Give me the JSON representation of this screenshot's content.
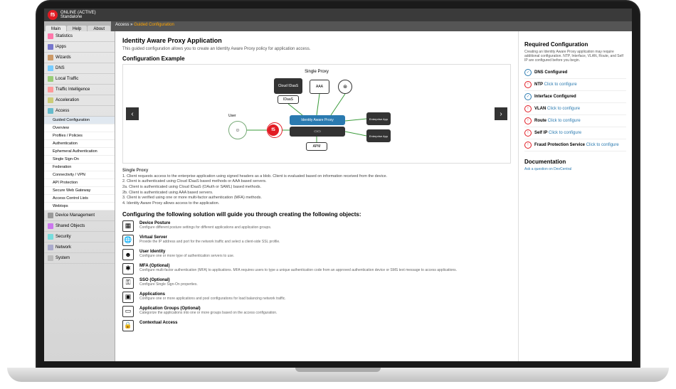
{
  "header": {
    "status": "ONLINE (ACTIVE)",
    "mode": "Standalone"
  },
  "tabs": [
    "Main",
    "Help",
    "About"
  ],
  "breadcrumb": {
    "root": "Access",
    "current": "Guided Configuration"
  },
  "sidebar": {
    "items": [
      {
        "label": "Statistics"
      },
      {
        "label": "iApps"
      },
      {
        "label": "Wizards"
      },
      {
        "label": "DNS"
      },
      {
        "label": "Local Traffic"
      },
      {
        "label": "Traffic Intelligence"
      },
      {
        "label": "Acceleration"
      },
      {
        "label": "Access",
        "expanded": true,
        "children": [
          "Guided Configuration",
          "Overview",
          "Profiles / Policies",
          "Authentication",
          "Ephemeral Authentication",
          "Single Sign-On",
          "Federation",
          "Connectivity / VPN",
          "API Protection",
          "Secure Web Gateway",
          "Access Control Lists",
          "Webtops"
        ]
      },
      {
        "label": "Device Management"
      },
      {
        "label": "Shared Objects"
      },
      {
        "label": "Security"
      },
      {
        "label": "Network"
      },
      {
        "label": "System"
      }
    ]
  },
  "page": {
    "title": "Identity Aware Proxy Application",
    "description": "This guided configuration allows you to create an Identity Aware Proxy policy for application access.",
    "example_heading": "Configuration Example",
    "diagram": {
      "title": "Single Proxy",
      "nodes": {
        "cloud": "Cloud IDaaS",
        "idaas": "IDaaS",
        "aaa": "AAA",
        "mfa": "MFA",
        "user": "User",
        "iap": "Identity Aware Proxy",
        "apm": "APM",
        "ent1": "Enterprise App",
        "ent2": "Enterprise App"
      }
    },
    "steps": {
      "heading": "Single Proxy",
      "list": [
        "1. Client requests access to the enterprise application using signed headers as a blob. Client is evaluated based on information received from the device.",
        "2. Client is authenticated using Cloud IDaaS based methods or AAA based servers.",
        "2a. Client is authenticated using Cloud IDaaS (OAuth or SAML) based methods.",
        "2b. Client is authenticated using AAA based servers.",
        "3. Client is verified using one or more multi-factor authentication (MFA) methods.",
        "4. Identity Aware Proxy allows access to the application."
      ]
    },
    "config_heading": "Configuring the following solution will guide you through creating the following objects:",
    "objects": [
      {
        "name": "Device Posture",
        "desc": "Configure different posture settings for different applications and application groups."
      },
      {
        "name": "Virtual Server",
        "desc": "Provide the IP address and port for the network traffic and select a client-side SSL profile."
      },
      {
        "name": "User Identity",
        "desc": "Configure one or more type of authentication servers to use."
      },
      {
        "name": "MFA (Optional)",
        "desc": "Configure multi-factor authentication (MFA) to applications. MFA requires users to type a unique authentication code from an approved authentication device or SMS text message to access applications."
      },
      {
        "name": "SSO (Optional)",
        "desc": "Configure Single Sign-On properties."
      },
      {
        "name": "Applications",
        "desc": "Configure one or more applications and pool configurations for load balancing network traffic."
      },
      {
        "name": "Application Groups (Optional)",
        "desc": "Categorize the applications into one or more groups based on the access configuration."
      },
      {
        "name": "Contextual Access",
        "desc": ""
      }
    ]
  },
  "required": {
    "heading": "Required Configuration",
    "intro": "Creating an Identity Aware Proxy application may require additional configuration. NTP, Interface, VLAN, Route, and Self IP are configured before you begin.",
    "items": [
      {
        "label": "DNS Configured",
        "ok": true
      },
      {
        "label": "NTP",
        "ok": false,
        "action": "Click to configure"
      },
      {
        "label": "Interface Configured",
        "ok": true
      },
      {
        "label": "VLAN",
        "ok": false,
        "action": "Click to configure"
      },
      {
        "label": "Route",
        "ok": false,
        "action": "Click to configure"
      },
      {
        "label": "Self IP",
        "ok": false,
        "action": "Click to configure"
      },
      {
        "label": "Fraud Protection Service",
        "ok": false,
        "action": "Click to configure"
      }
    ],
    "doc_heading": "Documentation",
    "doc_link": "Ask a question on DevCentral"
  }
}
